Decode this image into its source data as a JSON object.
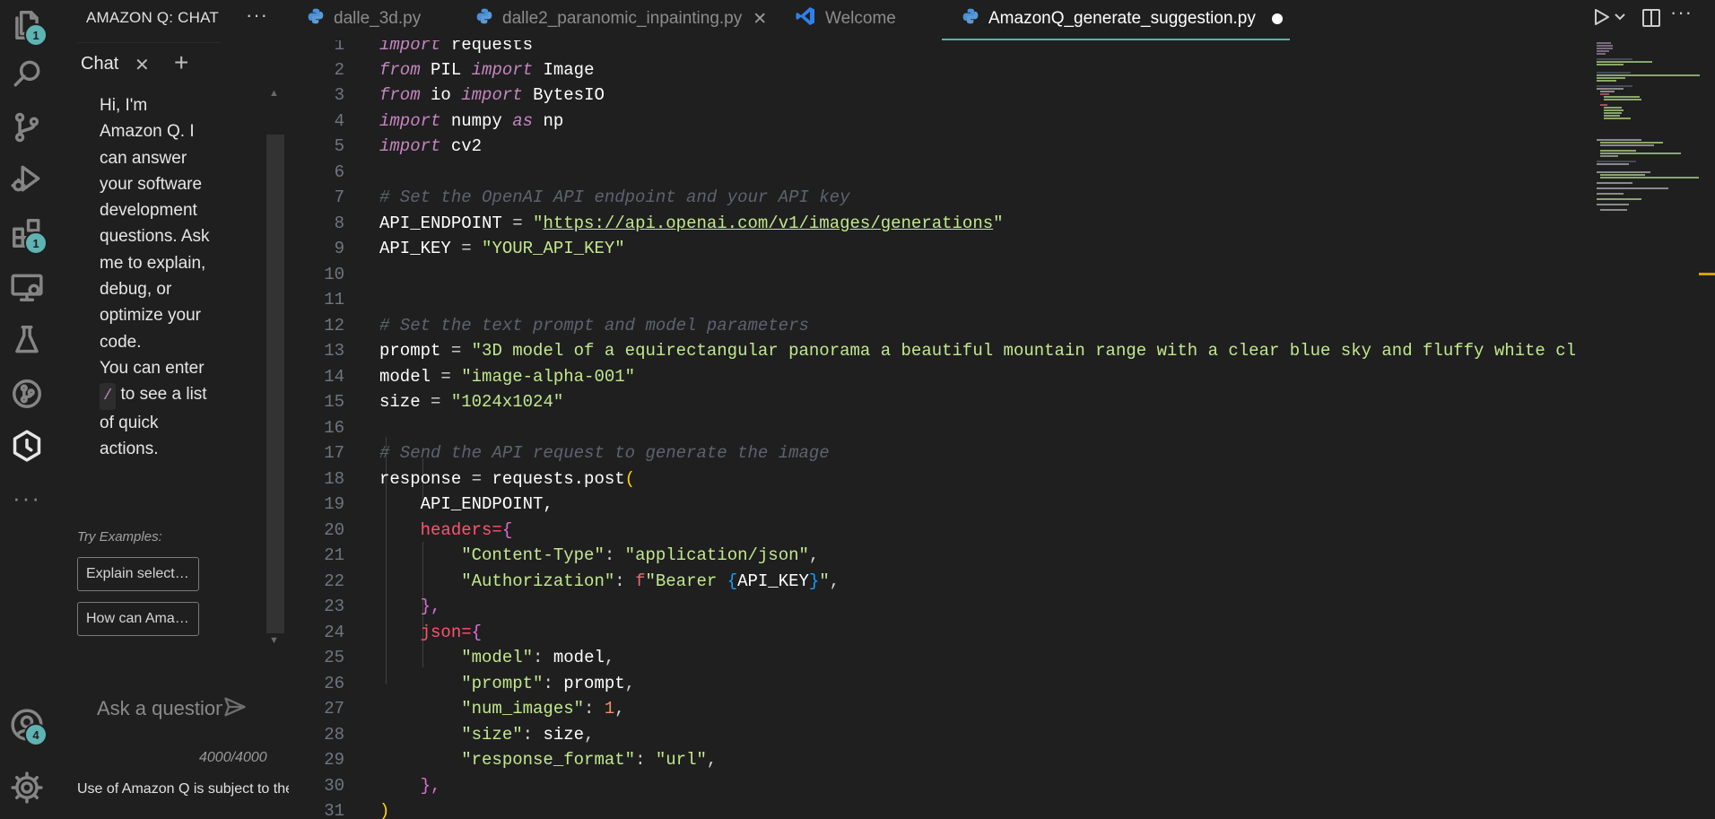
{
  "activity_bar": {
    "items": [
      {
        "name": "explorer-icon",
        "badge": "1"
      },
      {
        "name": "search-icon",
        "badge": ""
      },
      {
        "name": "source-control-icon",
        "badge": ""
      },
      {
        "name": "run-debug-icon",
        "badge": ""
      },
      {
        "name": "extensions-icon",
        "badge": "1"
      },
      {
        "name": "remote-explorer-icon",
        "badge": ""
      },
      {
        "name": "testing-icon",
        "badge": ""
      },
      {
        "name": "git-graph-icon",
        "badge": ""
      },
      {
        "name": "amazon-q-icon",
        "badge": ""
      },
      {
        "name": "more-icon",
        "badge": ""
      }
    ],
    "bottom": [
      {
        "name": "account-icon",
        "badge": "4"
      },
      {
        "name": "settings-gear-icon",
        "badge": ""
      }
    ]
  },
  "side_panel": {
    "title": "AMAZON Q: CHAT",
    "more": "···",
    "chat_tab": "Chat",
    "close_glyph": "✕",
    "add_glyph": "+",
    "welcome_line1": "Hi, I'm Amazon Q. I can answer your software development questions. Ask me to explain, debug, or optimize your code.",
    "welcome_line2a": "You can enter",
    "slash": "/",
    "welcome_line2b": "to see a list of quick actions.",
    "try_examples": "Try Examples:",
    "example1": "Explain selected code",
    "example2": "How can Amazon Q help me?",
    "ask_placeholder": "Ask a question...",
    "char_count": "4000/4000",
    "terms": "Use of Amazon Q is subject to the AWS Responsible AI Policy"
  },
  "tabs": [
    {
      "label": "dalle_3d.py",
      "icon": "python-icon",
      "active": false
    },
    {
      "label": "dalle2_paranomic_inpainting.py",
      "icon": "python-icon",
      "active": false,
      "close": "✕"
    },
    {
      "label": "Welcome",
      "icon": "vscode-icon",
      "active": false
    },
    {
      "label": "AmazonQ_generate_suggestion.py",
      "icon": "python-icon",
      "active": true
    }
  ],
  "editor": {
    "line_numbers": [
      "1",
      "2",
      "3",
      "4",
      "5",
      "6",
      "7",
      "8",
      "9",
      "10",
      "11",
      "12",
      "13",
      "14",
      "15",
      "16",
      "17",
      "18",
      "19",
      "20",
      "21",
      "22",
      "23",
      "24",
      "25",
      "26",
      "27",
      "28",
      "29",
      "30",
      "31"
    ],
    "code": {
      "kw_import": "import",
      "kw_from": "from",
      "kw_as": "as",
      "requests": "requests",
      "PIL": "PIL",
      "Image": "Image",
      "io": "io",
      "BytesIO": "BytesIO",
      "numpy": "numpy",
      "np": "np",
      "cv2": "cv2",
      "c1": "# Set the OpenAI API endpoint and your API key",
      "api_endpoint_var": "API_ENDPOINT",
      "eq": " = ",
      "quote": "\"",
      "api_url": "https://api.openai.com/v1/images/generations",
      "api_key_var": "API_KEY",
      "api_key_val": "\"YOUR_API_KEY\"",
      "c2": "# Set the text prompt and model parameters",
      "prompt_var": "prompt",
      "prompt_val": "\"3D model of a equirectangular panorama a beautiful mountain range with a clear blue sky and fluffy white cl",
      "model_var": "model",
      "model_val": "\"image-alpha-001\"",
      "size_var": "size",
      "size_val": "\"1024x1024\"",
      "c3": "# Send the API request to generate the image",
      "response_var": "response",
      "requests_post": "requests.post",
      "paren_open": "(",
      "paren_close": ")",
      "api_endpoint_arg": "API_ENDPOINT,",
      "headers_kw": "headers=",
      "json_kw": "json=",
      "brace_open": "{",
      "brace_close": "},",
      "content_type_key": "\"Content-Type\"",
      "content_type_val": "\"application/json\"",
      "auth_key": "\"Authorization\"",
      "f_prefix": "f",
      "bearer": "\"Bearer ",
      "api_key_ref": "API_KEY",
      "fstr_close": "\"",
      "k_model": "\"model\"",
      "v_model": "model",
      "k_prompt": "\"prompt\"",
      "v_prompt": "prompt",
      "k_num_images": "\"num_images\"",
      "v_num_images": "1",
      "k_size": "\"size\"",
      "v_size": "size",
      "k_response_format": "\"response_format\"",
      "v_response_format": "\"url\"",
      "colon": ": ",
      "comma": ","
    }
  },
  "colors": {
    "background": "#1f1f1f",
    "active_tab_border": "#4db6ac",
    "badge": "#5fb3b3",
    "keyword": "#c586c0",
    "string": "#c3e88d",
    "comment": "#5c6370"
  }
}
